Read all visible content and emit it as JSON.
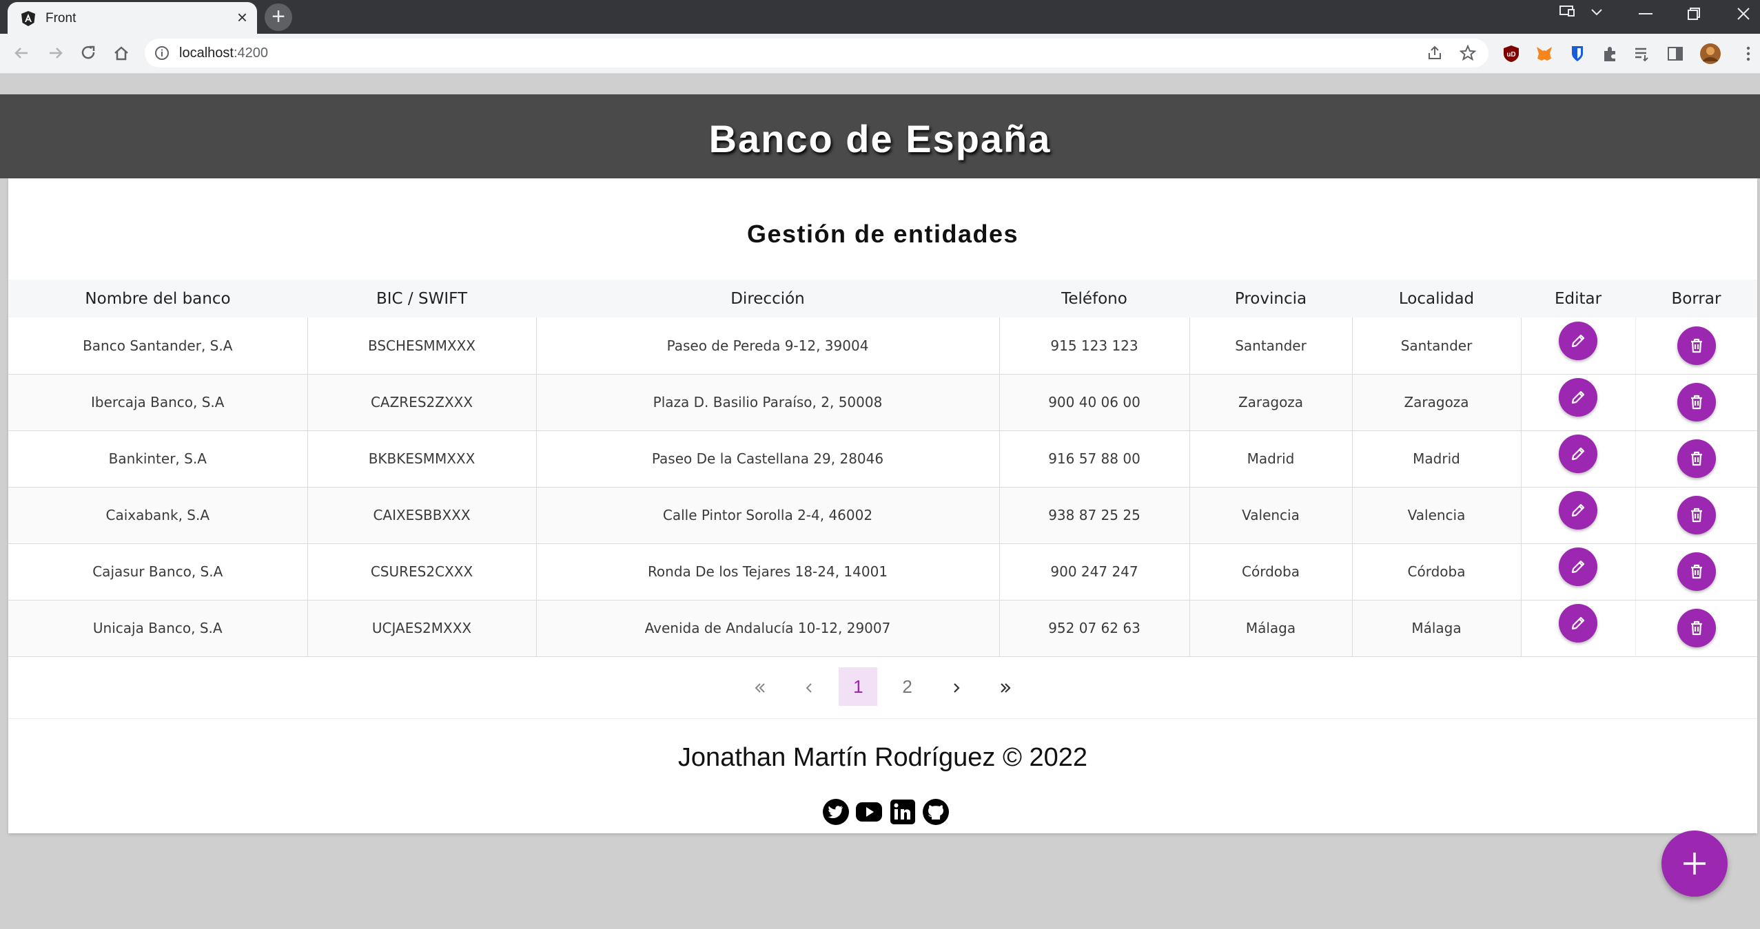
{
  "browser": {
    "tab_title": "Front",
    "tab_close": "×",
    "new_tab": "+",
    "url_host": "localhost",
    "url_port": ":4200"
  },
  "app": {
    "title": "Banco de España",
    "section_title": "Gestión de entidades"
  },
  "table": {
    "columns": [
      "Nombre del banco",
      "BIC / SWIFT",
      "Dirección",
      "Teléfono",
      "Provincia",
      "Localidad",
      "Editar",
      "Borrar"
    ],
    "rows": [
      {
        "name": "Banco Santander, S.A",
        "bic": "BSCHESMMXXX",
        "address": "Paseo de Pereda 9-12, 39004",
        "phone": "915 123 123",
        "province": "Santander",
        "locality": "Santander"
      },
      {
        "name": "Ibercaja Banco, S.A",
        "bic": "CAZRES2ZXXX",
        "address": "Plaza D. Basilio Paraíso, 2, 50008",
        "phone": "900 40 06 00",
        "province": "Zaragoza",
        "locality": "Zaragoza"
      },
      {
        "name": "Bankinter, S.A",
        "bic": "BKBKESMMXXX",
        "address": "Paseo De la Castellana 29, 28046",
        "phone": "916 57 88 00",
        "province": "Madrid",
        "locality": "Madrid"
      },
      {
        "name": "Caixabank, S.A",
        "bic": "CAIXESBBXXX",
        "address": "Calle Pintor Sorolla 2-4, 46002",
        "phone": "938 87 25 25",
        "province": "Valencia",
        "locality": "Valencia"
      },
      {
        "name": "Cajasur Banco, S.A",
        "bic": "CSURES2CXXX",
        "address": "Ronda De los Tejares 18-24, 14001",
        "phone": "900 247 247",
        "province": "Córdoba",
        "locality": "Córdoba"
      },
      {
        "name": "Unicaja Banco, S.A",
        "bic": "UCJAES2MXXX",
        "address": "Avenida de Andalucía 10-12, 29007",
        "phone": "952 07 62 63",
        "province": "Málaga",
        "locality": "Málaga"
      }
    ]
  },
  "pagination": {
    "pages": [
      "1",
      "2"
    ],
    "current": "1"
  },
  "footer": {
    "text": "Jonathan Martín Rodríguez © 2022",
    "socials": [
      "twitter-icon",
      "youtube-icon",
      "linkedin-icon",
      "github-icon"
    ]
  },
  "colors": {
    "accent": "#9c27b0",
    "header_bg": "#4a4a4a",
    "page_bg": "#cfcfcf"
  }
}
